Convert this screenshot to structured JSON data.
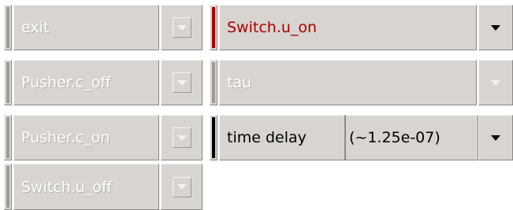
{
  "left_column": [
    {
      "label": "exit",
      "enabled": false
    },
    {
      "label": "Pusher.c_off",
      "enabled": false
    },
    {
      "label": "Pusher.c_on",
      "enabled": false
    },
    {
      "label": "Switch.u_off",
      "enabled": false
    }
  ],
  "right_column": [
    {
      "label": "Switch.u_on",
      "enabled": true,
      "text_color": "#aa0000",
      "indicator_color": "#aa0000"
    },
    {
      "label": "tau",
      "enabled": false
    },
    {
      "label": "time delay",
      "value": "(~1.25e-07)",
      "enabled": true,
      "text_color": "#000000",
      "indicator_color": "#000000"
    }
  ],
  "colors": {
    "panel": "#d8d4d0",
    "disabled_text": "#ffffff",
    "active_red": "#aa0000"
  }
}
